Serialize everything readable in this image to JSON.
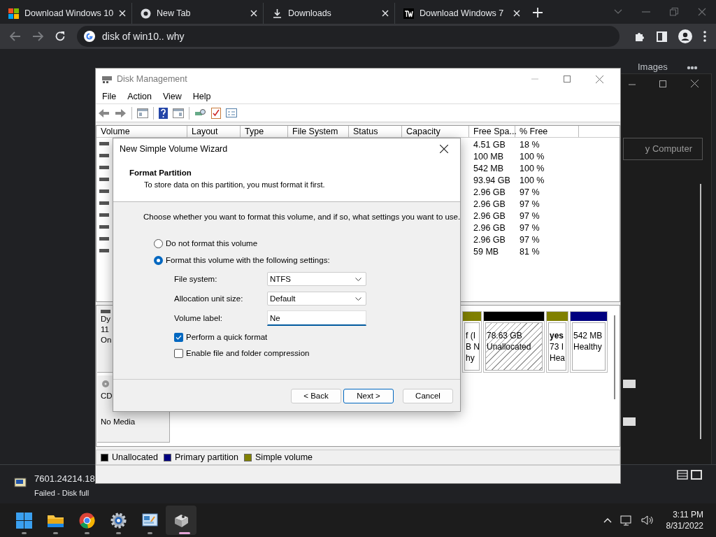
{
  "browser": {
    "tabs": [
      {
        "title": "Download Windows 10"
      },
      {
        "title": "New Tab"
      },
      {
        "title": "Downloads"
      },
      {
        "title": "Download Windows 7"
      }
    ],
    "address": "disk of win10.. why"
  },
  "background_page": {
    "links": [
      "Images"
    ],
    "field": "y Computer"
  },
  "disk_management": {
    "title": "Disk Management",
    "menu": [
      "File",
      "Action",
      "View",
      "Help"
    ],
    "columns": [
      "Volume",
      "Layout",
      "Type",
      "File System",
      "Status",
      "Capacity",
      "Free Spa...",
      "% Free"
    ],
    "rows": [
      {
        "free": "4.51 GB",
        "percent": "18 %"
      },
      {
        "free": "100 MB",
        "percent": "100 %"
      },
      {
        "free": "542 MB",
        "percent": "100 %"
      },
      {
        "free": "93.94 GB",
        "percent": "100 %"
      },
      {
        "free": "2.96 GB",
        "percent": "97 %"
      },
      {
        "free": "2.96 GB",
        "percent": "97 %"
      },
      {
        "free": "2.96 GB",
        "percent": "97 %"
      },
      {
        "free": "2.96 GB",
        "percent": "97 %"
      },
      {
        "free": "2.96 GB",
        "percent": "97 %"
      },
      {
        "free": "59 MB",
        "percent": "81 %"
      }
    ],
    "disks": [
      {
        "kind": "disk",
        "lines": [
          "Dy",
          "11",
          "On"
        ]
      },
      {
        "kind": "cdrom",
        "lines": [
          "CD",
          "No Media"
        ]
      }
    ],
    "partitions": [
      {
        "kind": "volume",
        "color": "#808000",
        "lines": [
          "f (I",
          "B N",
          "hy"
        ]
      },
      {
        "kind": "unallocated",
        "color": "#000000",
        "lines": [
          "78.63 GB",
          "Unallocated"
        ]
      },
      {
        "kind": "volume",
        "color": "#808000",
        "lines": [
          "yes",
          "73 I",
          "Hea"
        ]
      },
      {
        "kind": "volume",
        "color": "#000080",
        "lines": [
          "542 MB",
          "Healthy"
        ]
      }
    ],
    "legend": [
      {
        "label": "Unallocated",
        "color": "#000000"
      },
      {
        "label": "Primary partition",
        "color": "#000080"
      },
      {
        "label": "Simple volume",
        "color": "#808000"
      }
    ]
  },
  "wizard": {
    "title": "New Simple Volume Wizard",
    "heading": "Format Partition",
    "subheading": "To store data on this partition, you must format it first.",
    "prompt": "Choose whether you want to format this volume, and if so, what settings you want to use.",
    "options": [
      {
        "label": "Do not format this volume",
        "selected": false
      },
      {
        "label": "Format this volume with the following settings:",
        "selected": true
      }
    ],
    "fields": [
      {
        "kind": "select",
        "label": "File system:",
        "value": "NTFS"
      },
      {
        "kind": "select",
        "label": "Allocation unit size:",
        "value": "Default"
      },
      {
        "kind": "text",
        "label": "Volume label:",
        "value": "Ne"
      }
    ],
    "checkboxes": [
      {
        "label": "Perform a quick format",
        "checked": true
      },
      {
        "label": "Enable file and folder compression",
        "checked": false
      }
    ],
    "buttons": [
      {
        "label": "< Back",
        "default": false
      },
      {
        "label": "Next >",
        "default": true
      },
      {
        "label": "Cancel",
        "default": false
      }
    ]
  },
  "download": {
    "file": "7601.24214.18",
    "status": "Failed - Disk full"
  },
  "taskbar": {
    "apps": [
      {
        "kind": "start",
        "active": false
      },
      {
        "kind": "folder",
        "active": false
      },
      {
        "kind": "chrome",
        "active": false
      },
      {
        "kind": "gear",
        "active": false
      },
      {
        "kind": "control",
        "active": false
      },
      {
        "kind": "disk",
        "active": true
      }
    ],
    "time": "3:11 PM",
    "date": "8/31/2022"
  }
}
